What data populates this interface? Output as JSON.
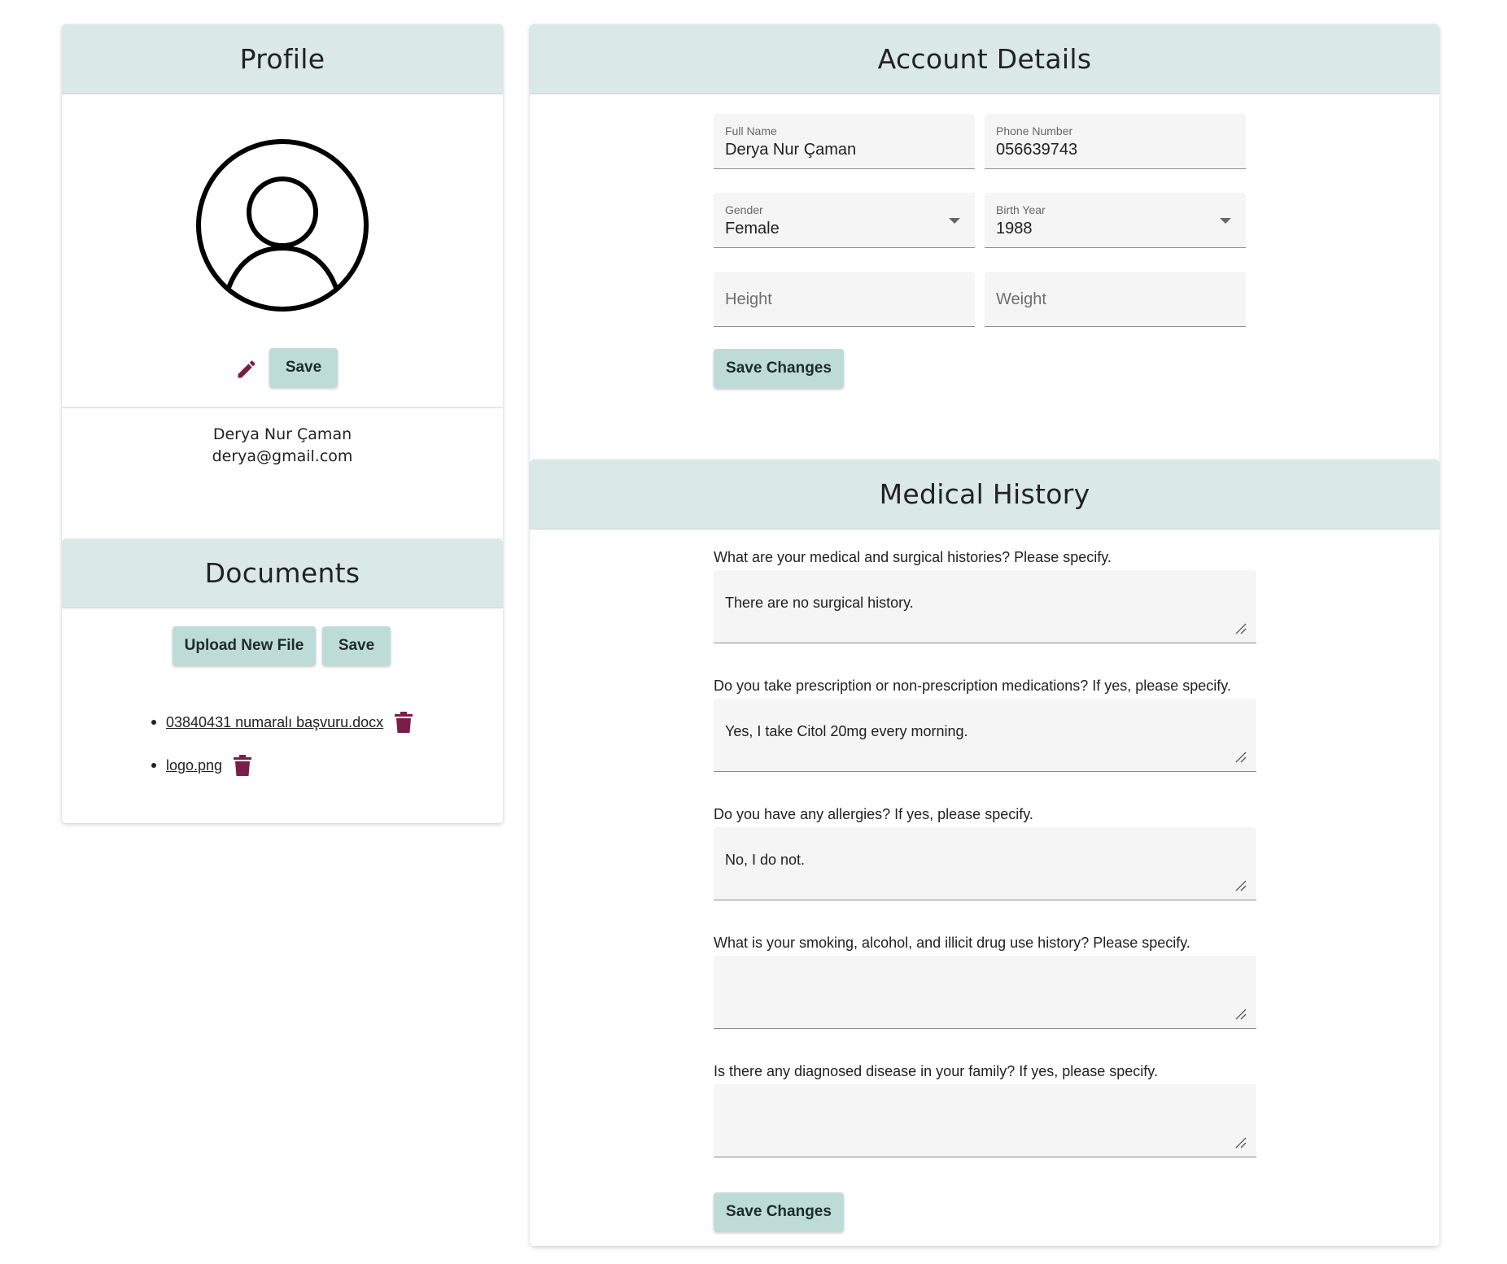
{
  "profile": {
    "title": "Profile",
    "save_label": "Save",
    "name": "Derya Nur Çaman",
    "email": "derya@gmail.com"
  },
  "documents": {
    "title": "Documents",
    "upload_label": "Upload New File",
    "save_label": "Save",
    "files": [
      "03840431 numaralı başvuru.docx",
      "logo.png"
    ]
  },
  "account": {
    "title": "Account Details",
    "full_name": {
      "label": "Full Name",
      "value": "Derya Nur Çaman"
    },
    "phone": {
      "label": "Phone Number",
      "value": "056639743"
    },
    "gender": {
      "label": "Gender",
      "value": "Female"
    },
    "birth_year": {
      "label": "Birth Year",
      "value": "1988"
    },
    "height": {
      "placeholder": "Height"
    },
    "weight": {
      "placeholder": "Weight"
    },
    "save_label": "Save Changes"
  },
  "medical": {
    "title": "Medical History",
    "questions": [
      {
        "label": "What are your medical and surgical histories? Please specify.",
        "value": "There are no surgical history."
      },
      {
        "label": "Do you take prescription or non-prescription medications? If yes, please specify.",
        "value": "Yes, I take Citol 20mg every morning."
      },
      {
        "label": "Do you have any allergies? If yes, please specify.",
        "value": "No, I do not."
      },
      {
        "label": "What is your smoking, alcohol, and illicit drug use history? Please specify.",
        "value": ""
      },
      {
        "label": "Is there any diagnosed disease in your family? If yes, please specify.",
        "value": ""
      }
    ],
    "save_label": "Save Changes"
  },
  "colors": {
    "header_bg": "#dae8e7",
    "button_bg": "#bddcd8",
    "icon_accent": "#7b1d4a",
    "field_bg": "#f5f5f5"
  },
  "icons": {
    "avatar": "account-circle-icon",
    "edit": "pencil-icon",
    "delete": "trash-icon"
  }
}
